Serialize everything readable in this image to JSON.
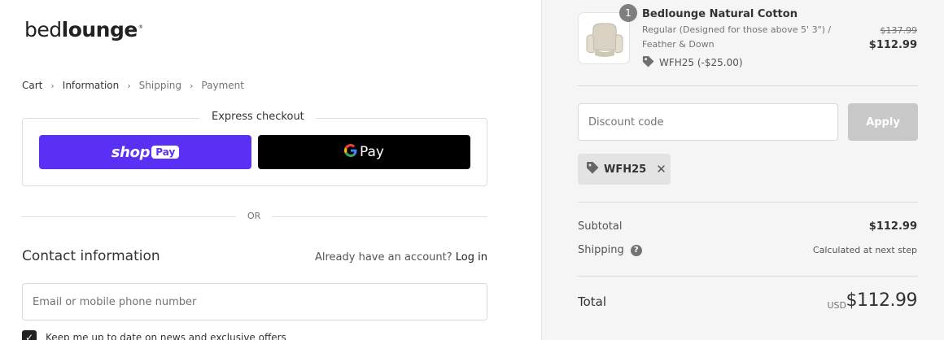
{
  "brand": {
    "logo_part1": "bed",
    "logo_part2": "lounge",
    "logo_mark": "®"
  },
  "breadcrumb": [
    {
      "label": "Cart"
    },
    {
      "label": "Information"
    },
    {
      "label": "Shipping"
    },
    {
      "label": "Payment"
    }
  ],
  "express": {
    "title": "Express checkout",
    "shoppay_label": "shop",
    "shoppay_badge": "Pay",
    "gpay_g": "G",
    "gpay_label": "Pay",
    "shoppay_color": "#5a31f4",
    "gpay_color": "#000000"
  },
  "or_text": "OR",
  "contact": {
    "heading": "Contact information",
    "account_prompt": "Already have an account?",
    "login_label": "Log in",
    "email_placeholder": "Email or mobile phone number",
    "newsletter_label": "Keep me up to date on news and exclusive offers",
    "newsletter_checked": true
  },
  "order": {
    "item": {
      "quantity": "1",
      "name": "Bedlounge Natural Cotton",
      "variant": "Regular (Designed for those above 5' 3\") / Feather & Down",
      "discount": "WFH25 (-$25.00)",
      "original_price": "$137.99",
      "price": "$112.99"
    },
    "discount_placeholder": "Discount code",
    "apply_label": "Apply",
    "applied_code": "WFH25",
    "subtotal_label": "Subtotal",
    "subtotal_value": "$112.99",
    "shipping_label": "Shipping",
    "shipping_help": "?",
    "shipping_value": "Calculated at next step",
    "total_label": "Total",
    "currency": "USD",
    "total_value": "$112.99"
  }
}
